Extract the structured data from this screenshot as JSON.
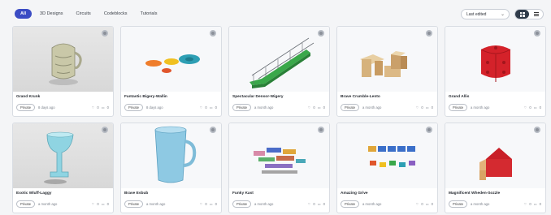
{
  "filters": [
    "All",
    "3D Designs",
    "Circuits",
    "Codeblocks",
    "Tutorials"
  ],
  "sort": {
    "label": "Last edited"
  },
  "cards": [
    {
      "title": "Grand Krunk",
      "visibility": "Private",
      "date": "8 days ago",
      "likes": "0",
      "comments": "0"
    },
    {
      "title": "Fantastic Bigery-Wallin",
      "visibility": "Private",
      "date": "8 days ago",
      "likes": "0",
      "comments": "0"
    },
    {
      "title": "Spectacular Densor-Wigery",
      "visibility": "Private",
      "date": "a month ago",
      "likes": "0",
      "comments": "0"
    },
    {
      "title": "Brave Crumble-Lento",
      "visibility": "Private",
      "date": "a month ago",
      "likes": "0",
      "comments": "0"
    },
    {
      "title": "Grand Allis",
      "visibility": "Private",
      "date": "a month ago",
      "likes": "0",
      "comments": "0"
    },
    {
      "title": "Exotic Wluff-Laggy",
      "visibility": "Private",
      "date": "a month ago",
      "likes": "0",
      "comments": "0"
    },
    {
      "title": "Brave Esbub",
      "visibility": "Private",
      "date": "a month ago",
      "likes": "0",
      "comments": "0"
    },
    {
      "title": "Funky Kast",
      "visibility": "Private",
      "date": "a month ago",
      "likes": "0",
      "comments": "0"
    },
    {
      "title": "Amazing Grive",
      "visibility": "Private",
      "date": "a month ago",
      "likes": "0",
      "comments": "0"
    },
    {
      "title": "Magnificent Wheden-Sozzle",
      "visibility": "Private",
      "date": "a month ago",
      "likes": "0",
      "comments": "0"
    }
  ]
}
